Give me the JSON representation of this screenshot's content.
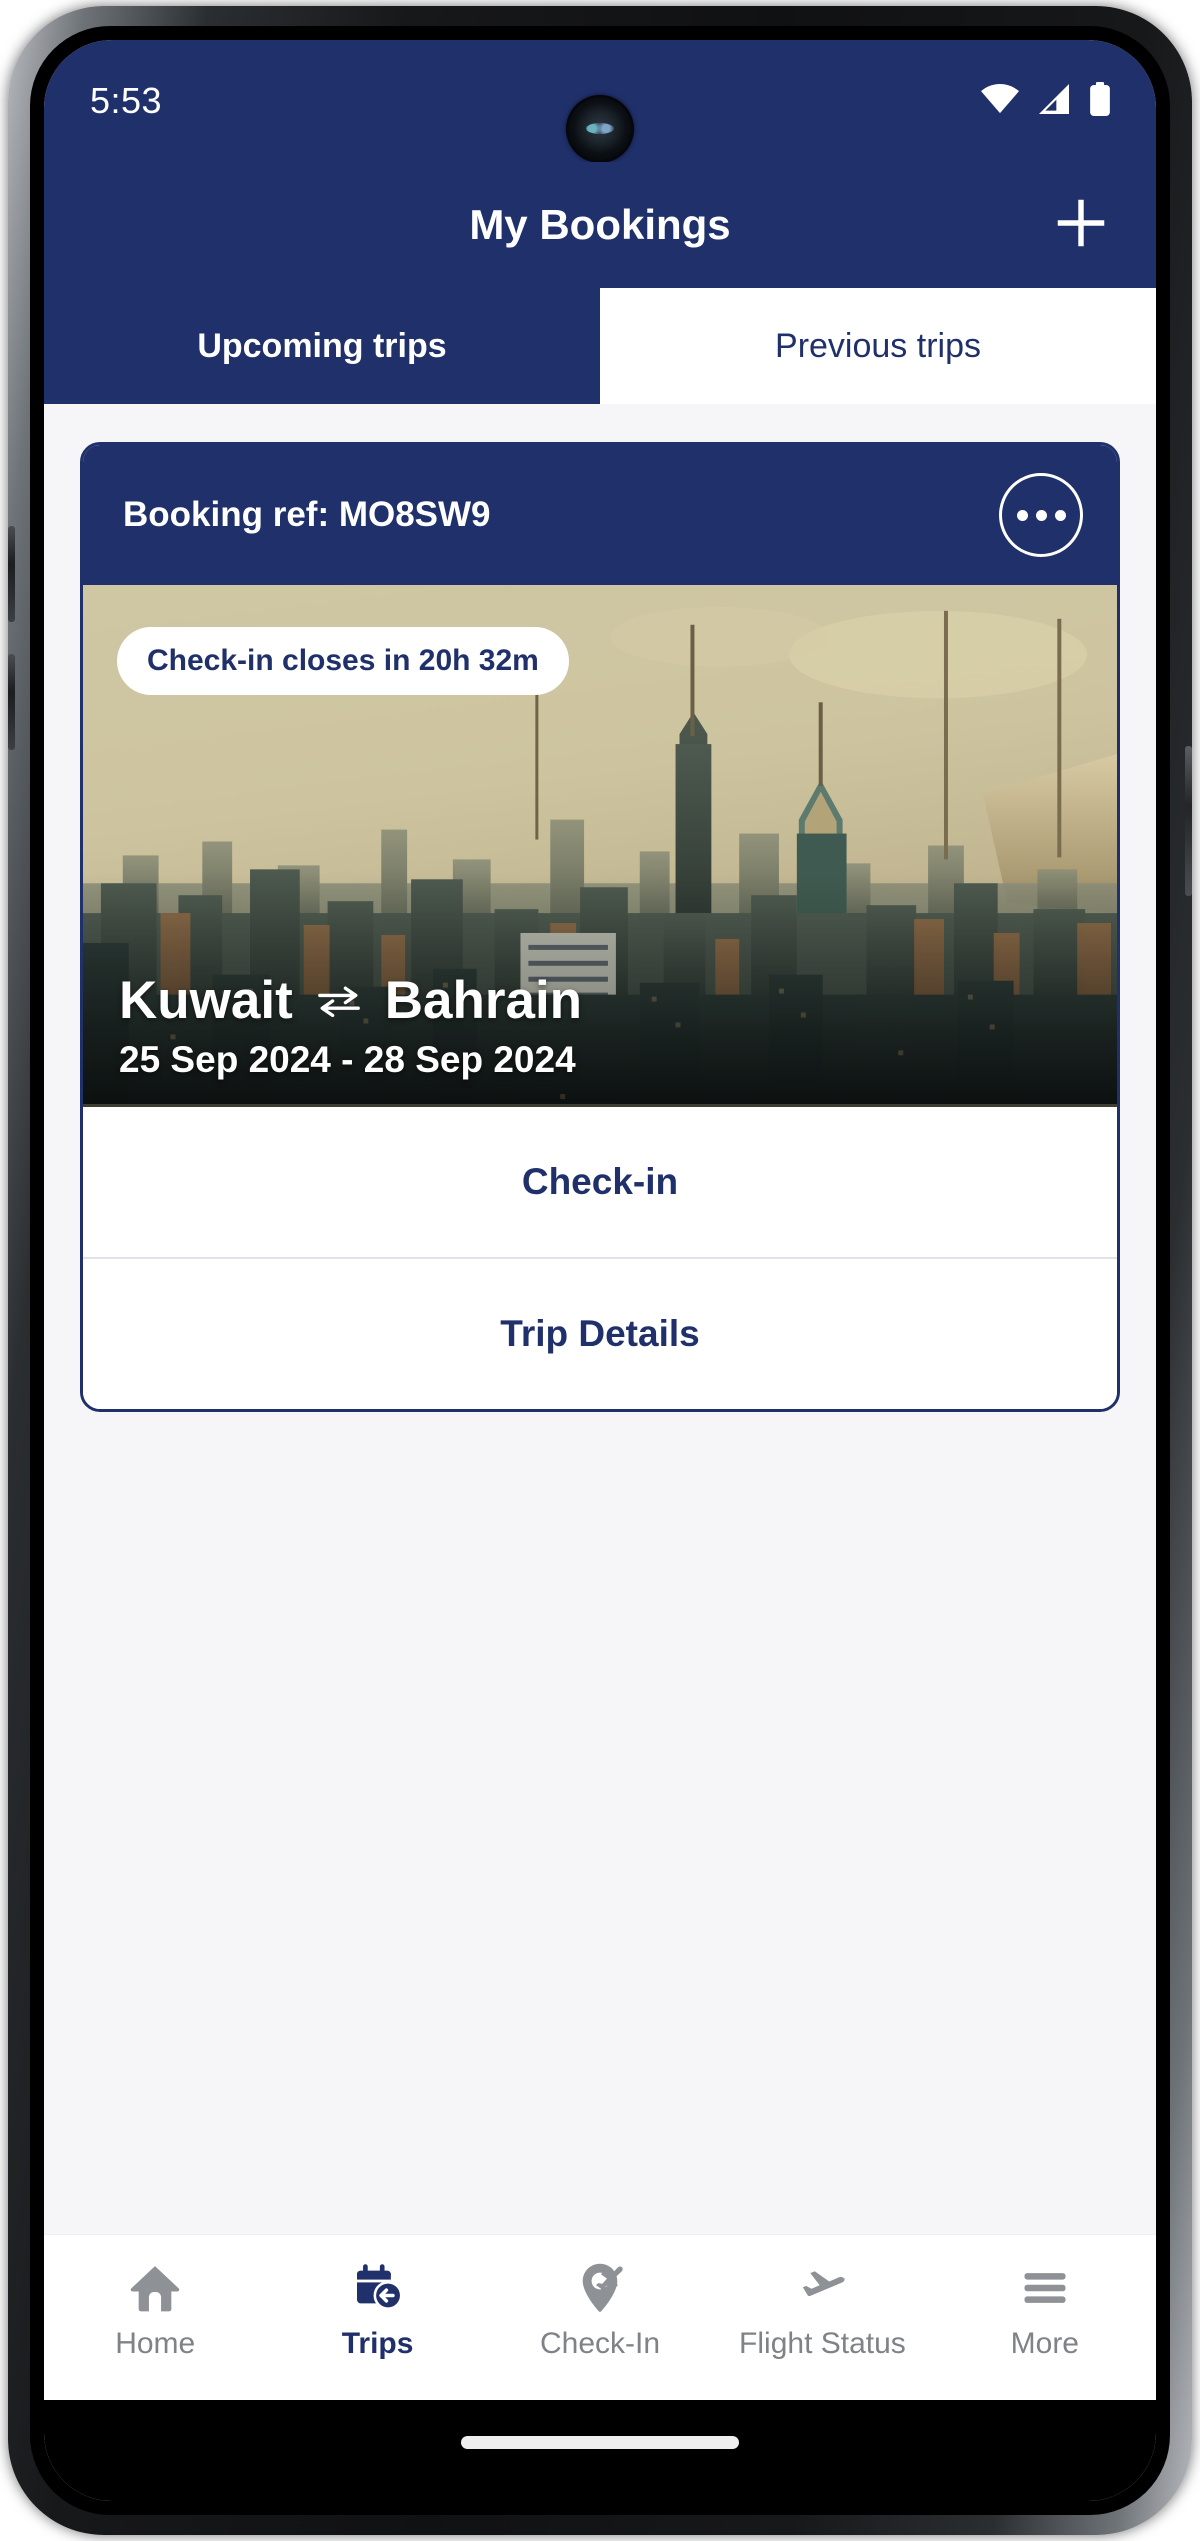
{
  "status_bar": {
    "time": "5:53",
    "icons": [
      "wifi-icon",
      "cellular-signal-icon",
      "battery-icon"
    ]
  },
  "app_bar": {
    "title": "My Bookings",
    "add_icon": "plus-icon"
  },
  "tabs": [
    {
      "label": "Upcoming trips",
      "active": true
    },
    {
      "label": "Previous trips",
      "active": false
    }
  ],
  "booking_card": {
    "booking_ref": "Booking ref: MO8SW9",
    "menu_icon": "overflow-menu-icon",
    "checkin_timer": "Check-in closes in 20h 32m",
    "origin": "Kuwait",
    "route_icon": "round-trip-arrows-icon",
    "destination": "Bahrain",
    "dates": "25 Sep 2024 - 28 Sep 2024",
    "actions": [
      {
        "label": "Check-in"
      },
      {
        "label": "Trip Details"
      }
    ]
  },
  "bottom_nav": [
    {
      "label": "Home",
      "icon": "home-icon",
      "active": false
    },
    {
      "label": "Trips",
      "icon": "trips-calendar-icon",
      "active": true
    },
    {
      "label": "Check-In",
      "icon": "checkin-pin-icon",
      "active": false
    },
    {
      "label": "Flight Status",
      "icon": "airplane-icon",
      "active": false
    },
    {
      "label": "More",
      "icon": "hamburger-menu-icon",
      "active": false
    }
  ],
  "colors": {
    "brand_navy": "#20306b",
    "inactive_gray": "#7f8287",
    "page_background": "#f6f6f8"
  }
}
